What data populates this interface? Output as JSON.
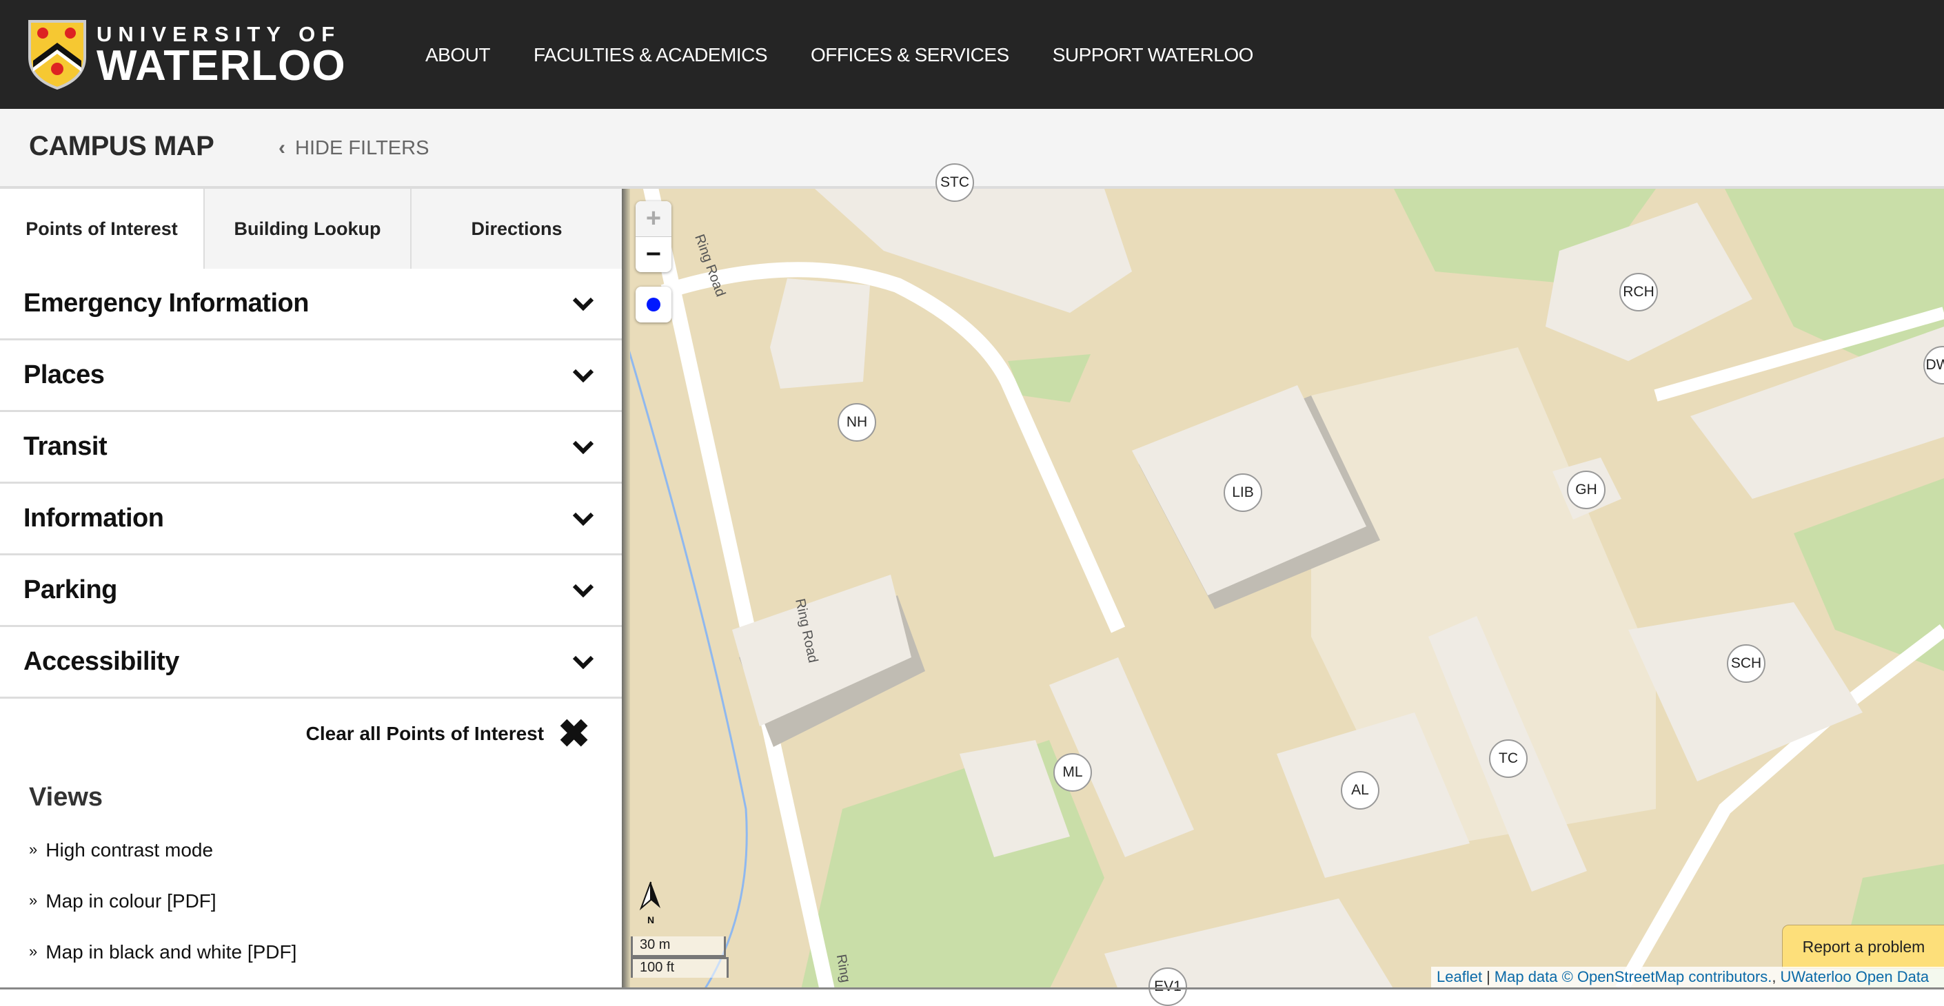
{
  "header": {
    "logo_line1": "UNIVERSITY OF",
    "logo_line2": "WATERLOO",
    "nav": [
      "ABOUT",
      "FACULTIES & ACADEMICS",
      "OFFICES & SERVICES",
      "SUPPORT WATERLOO"
    ]
  },
  "subbar": {
    "title": "CAMPUS MAP",
    "hide_filters": "HIDE FILTERS"
  },
  "sidebar": {
    "tabs": [
      {
        "label": "Points of Interest",
        "active": true
      },
      {
        "label": "Building Lookup",
        "active": false
      },
      {
        "label": "Directions",
        "active": false
      }
    ],
    "accordions": [
      "Emergency Information",
      "Places",
      "Transit",
      "Information",
      "Parking",
      "Accessibility"
    ],
    "clear_label": "Clear all Points of Interest",
    "views_heading": "Views",
    "views": [
      "High contrast mode",
      "Map in colour [PDF]",
      "Map in black and white [PDF]"
    ]
  },
  "map": {
    "zoom_in": "+",
    "zoom_out": "−",
    "north_label": "N",
    "scale_metric": "30 m",
    "scale_imperial": "100 ft",
    "road_labels": [
      "Ring Road",
      "Ring Road",
      "Ring"
    ],
    "buildings": [
      "STC",
      "NH",
      "LIB",
      "RCH",
      "GH",
      "DWE",
      "SCH",
      "TC",
      "AL",
      "ML",
      "EV1"
    ],
    "report_problem": "Report a problem",
    "attribution": {
      "leaflet": "Leaflet",
      "osm": "Map data © OpenStreetMap contributors.",
      "uw": "UWaterloo Open Data"
    },
    "colors": {
      "land": "#e9dcba",
      "building": "#efebe4",
      "shadow": "#c0bcb3",
      "grass": "#c9dea8",
      "road": "#ffffff",
      "locate_dot": "#0018ff",
      "report_bg": "#fddf7a",
      "link": "#0b6aa8"
    }
  }
}
